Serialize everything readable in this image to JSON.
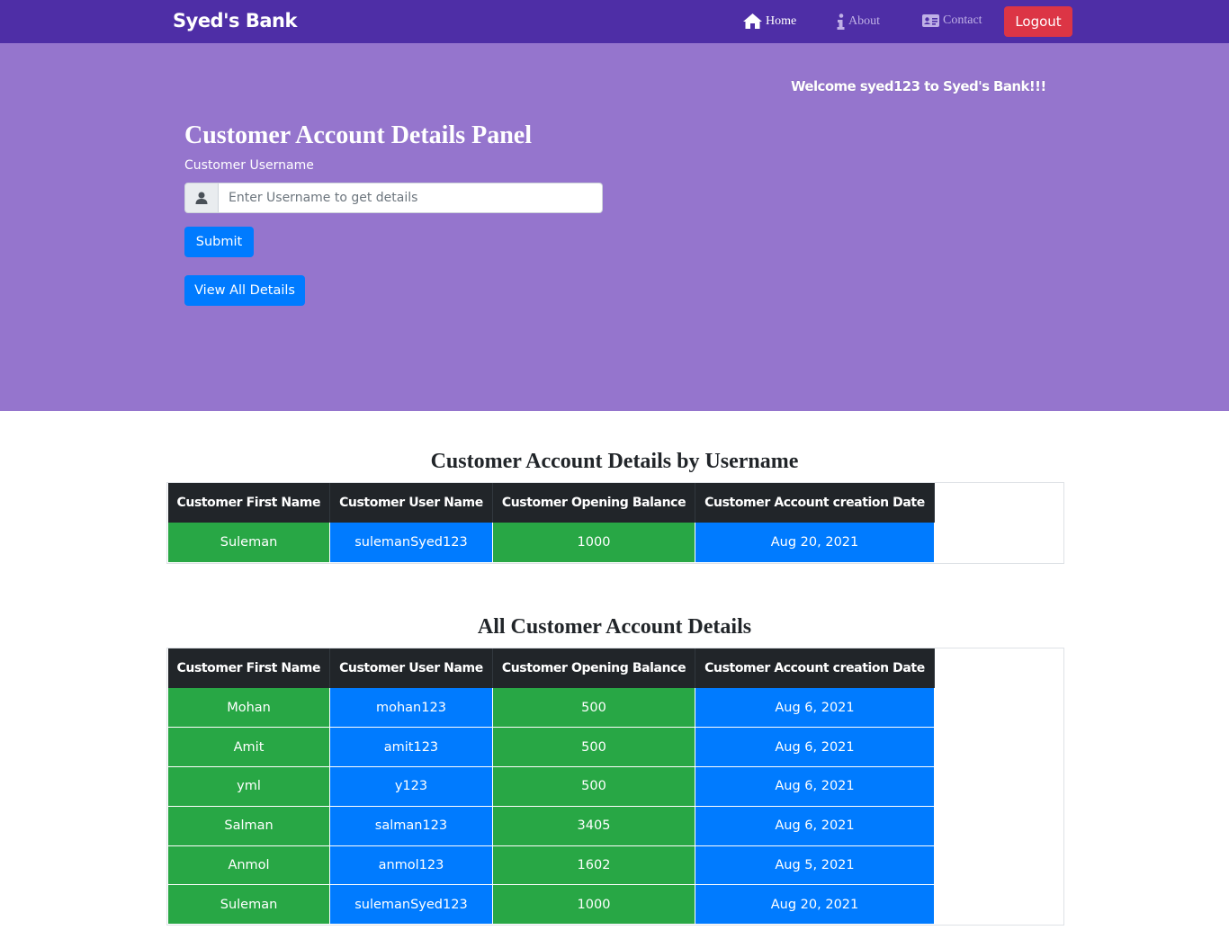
{
  "navbar": {
    "brand": "Syed's Bank",
    "links": [
      {
        "label": "Home",
        "icon": "home-icon"
      },
      {
        "label": "About",
        "icon": "info-icon"
      },
      {
        "label": "Contact",
        "icon": "id-card-icon"
      }
    ],
    "logout_label": "Logout"
  },
  "hero": {
    "welcome": "Welcome syed123 to Syed's Bank!!!",
    "panel_title": "Customer Account Details Panel",
    "username_label": "Customer Username",
    "username_placeholder": "Enter Username to get details",
    "username_value": "",
    "submit_label": "Submit",
    "view_all_label": "View All Details"
  },
  "colors": {
    "navbar": "#4e2ea6",
    "hero": "#9575cd",
    "green": "#28a745",
    "blue": "#007bff",
    "danger": "#dc3545",
    "table_head": "#212529"
  },
  "table_columns": [
    "Customer First Name",
    "Customer User Name",
    "Customer Opening Balance",
    "Customer Account creation Date"
  ],
  "by_username": {
    "title": "Customer Account Details by Username",
    "rows": [
      [
        "Suleman",
        "sulemanSyed123",
        "1000",
        "Aug 20, 2021"
      ]
    ]
  },
  "all_accounts": {
    "title": "All Customer Account Details",
    "rows": [
      [
        "Mohan",
        "mohan123",
        "500",
        "Aug 6, 2021"
      ],
      [
        "Amit",
        "amit123",
        "500",
        "Aug 6, 2021"
      ],
      [
        "yml",
        "y123",
        "500",
        "Aug 6, 2021"
      ],
      [
        "Salman",
        "salman123",
        "3405",
        "Aug 6, 2021"
      ],
      [
        "Anmol",
        "anmol123",
        "1602",
        "Aug 5, 2021"
      ],
      [
        "Suleman",
        "sulemanSyed123",
        "1000",
        "Aug 20, 2021"
      ]
    ]
  }
}
